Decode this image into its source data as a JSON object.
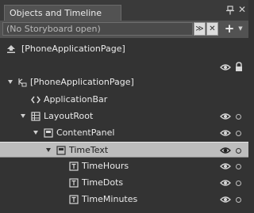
{
  "panel": {
    "title": "Objects and Timeline",
    "pin_glyph": "pin-icon",
    "close_glyph": "✕"
  },
  "storyboard": {
    "value": "(No Storyboard open)",
    "dropdown_glyph": "≫",
    "close_glyph": "✕",
    "add_glyph": "+",
    "add_dropdown_glyph": "▼"
  },
  "scope": {
    "label": "[PhoneApplicationPage]",
    "icon": "scope-up-icon"
  },
  "tree": {
    "root": {
      "label": "[PhoneApplicationPage]",
      "icon": "page-icon",
      "expanded": true
    },
    "items": [
      {
        "label": "ApplicationBar",
        "icon": "code-brackets-icon"
      },
      {
        "label": "LayoutRoot",
        "icon": "grid-icon",
        "expanded": true
      },
      {
        "label": "ContentPanel",
        "icon": "stackpanel-icon",
        "expanded": true
      },
      {
        "label": "TimeText",
        "icon": "stackpanel-icon",
        "expanded": true,
        "selected": true
      },
      {
        "label": "TimeHours",
        "icon": "textblock-icon"
      },
      {
        "label": "TimeDots",
        "icon": "textblock-icon"
      },
      {
        "label": "TimeMinutes",
        "icon": "textblock-icon"
      }
    ]
  },
  "colors": {
    "panel_bg": "#333333",
    "toolbar_bg": "#525252",
    "selection_bg": "#bdbdbd"
  }
}
